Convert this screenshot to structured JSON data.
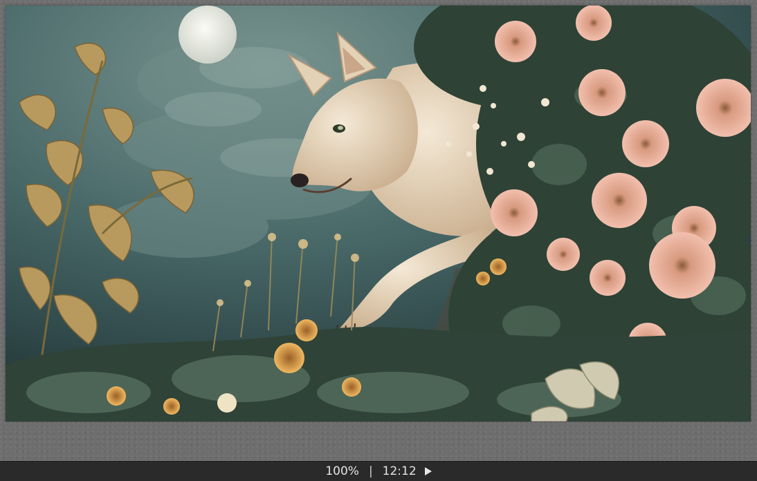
{
  "status_bar": {
    "zoom": "100%",
    "separator": "|",
    "time": "12:12",
    "play_icon": "play-icon"
  },
  "image": {
    "subject": "wolf-among-flowers-painting",
    "palette": {
      "sky": "#3d5a5c",
      "moon": "#e6e8e0",
      "wolf_fur": "#e8d8c0",
      "flower_pink": "#e8a898",
      "leaf_gold": "#b8a060",
      "foliage_dark": "#2a3a32"
    }
  },
  "viewer": {
    "background": "#6e6e6e",
    "status_bar_bg": "#2a2a2a"
  }
}
